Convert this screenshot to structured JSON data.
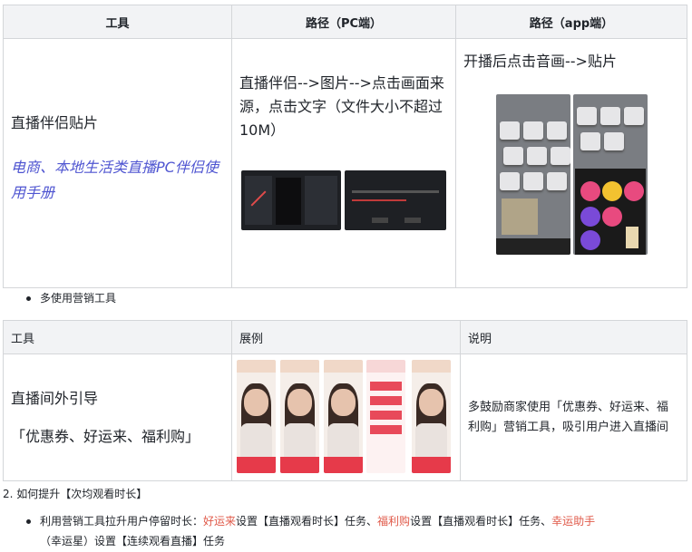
{
  "table1": {
    "headers": [
      "工具",
      "路径（PC端）",
      "路径（app端）"
    ],
    "tool_name": "直播伴侣贴片",
    "manual_link": "电商、本地生活类直播PC伴侣使用手册",
    "pc_path": "直播伴侣-->图片-->点击画面来源，点击文字（文件大小不超过10M）",
    "app_path": "开播后点击音画-->贴片"
  },
  "bullet1": "多使用营销工具",
  "table2": {
    "headers": [
      "工具",
      "展例",
      "说明"
    ],
    "tool_name": "直播间外引导",
    "tool_sub": "「优惠券、好运来、福利购」",
    "description": "多鼓励商家使用「优惠券、好运来、福利购」营销工具，吸引用户进入直播间"
  },
  "section2": "2. 如何提升【次均观看时长】",
  "bullet2": {
    "prefix": "利用营销工具拉升用户停留时长：",
    "hl1": "好运来",
    "t1": "设置【直播观看时长】任务、",
    "hl2": "福利购",
    "t2": "设置【直播观看时长】任务、",
    "hl3": "幸运助手",
    "t3": "（幸运星）设置【连续观看直播】任务"
  }
}
